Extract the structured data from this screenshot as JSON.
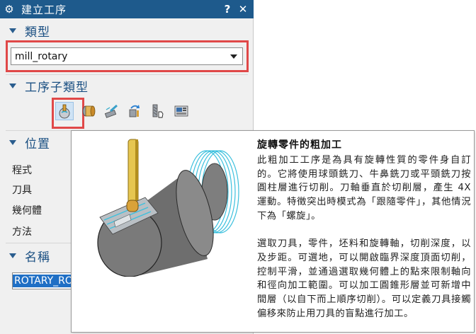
{
  "window": {
    "title": "建立工序",
    "help_label": "?",
    "close_label": "✕",
    "icon": "gear-icon"
  },
  "sections": {
    "type": {
      "label": "類型",
      "selected": "mill_rotary"
    },
    "subtype": {
      "label": "工序子類型",
      "icons": [
        "ball-cutter-roughing-icon",
        "cylinder-cutter-icon",
        "spray-cutter-icon",
        "rotary-arrow-icon",
        "shaft-hand-icon",
        "control-panel-icon"
      ]
    },
    "position": {
      "label": "位置",
      "fields": [
        "程式",
        "刀具",
        "幾何體",
        "方法"
      ]
    },
    "name": {
      "label": "名稱",
      "value": "ROTARY_ROUGH"
    }
  },
  "tooltip": {
    "title": "旋轉零件的粗加工",
    "paragraph1": "此粗加工工序是為具有旋轉性質的零件身自訂的。它將使用球頭銑刀、牛鼻銑刀或平頭銑刀按圓柱層進行切削。刀軸垂直於切削層，產生 4X 運動。特徵突出時模式為「跟隨零件」，其他情況下為「螺旋」。",
    "paragraph2": "選取刀具，零件，坯料和旋轉軸，切削深度，以及步距。可選地，可以開啟臨界深度頂面切削，控制平滑，並通過選取幾何體上的點來限制軸向和徑向加工範圍。可以加工圓錐形層並可新增中間層（以自下而上順序切削）。可以定義刀具接觸偏移來防止用刀具的盲點進行加工。"
  },
  "colors": {
    "titlebar": "#1e5a8c",
    "section_label": "#1a4f82",
    "highlight_box": "#e04848",
    "selection": "#1f6fc5"
  }
}
